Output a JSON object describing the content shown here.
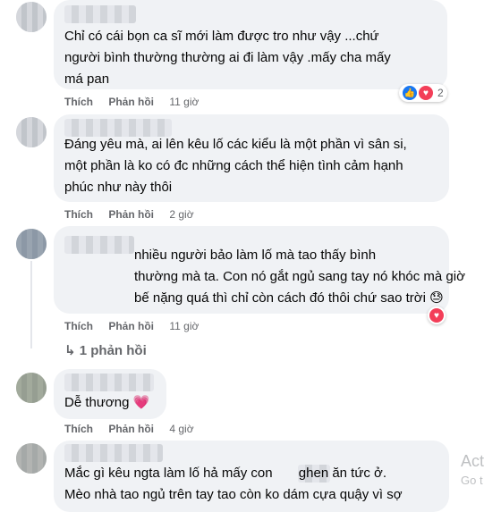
{
  "comments": [
    {
      "text": "Chỉ có cái bọn ca sĩ mới làm được tro như vậy ...chứ\nngười bình thường thường ai đi làm vậy .mấy cha mấy\nmá pan",
      "actions": {
        "like": "Thích",
        "reply": "Phản hồi",
        "time": "11 giờ"
      },
      "reaction_count": "2"
    },
    {
      "text": "Đáng yêu mà, ai lên kêu lố các kiểu là một phần vì sân si,\nmột phần là ko có đc những cách thể hiện tình cảm hạnh\nphúc như này thôi",
      "actions": {
        "like": "Thích",
        "reply": "Phản hồi",
        "time": "2 giờ"
      }
    },
    {
      "text": "nhiều người bảo làm lố mà tao thấy bình\nthường mà ta. Con nó gắt ngủ sang tay nó khóc mà giờ\nbế nặng quá thì chỉ còn cách đó thôi chứ sao trời 😓",
      "actions": {
        "like": "Thích",
        "reply": "Phản hồi",
        "time": "11 giờ"
      },
      "replies_link": "↳ 1 phản hồi"
    },
    {
      "text": "Dễ thương 💗",
      "actions": {
        "like": "Thích",
        "reply": "Phản hồi",
        "time": "4 giờ"
      }
    },
    {
      "text": "Mắc gì kêu ngta làm lố hả mấy con       ghen ăn tức ở.\nMèo nhà tao ngủ trên tay tao còn ko dám cựa quậy vì sợ"
    }
  ],
  "watermark": {
    "line1": "Act",
    "line2": "Go t"
  }
}
